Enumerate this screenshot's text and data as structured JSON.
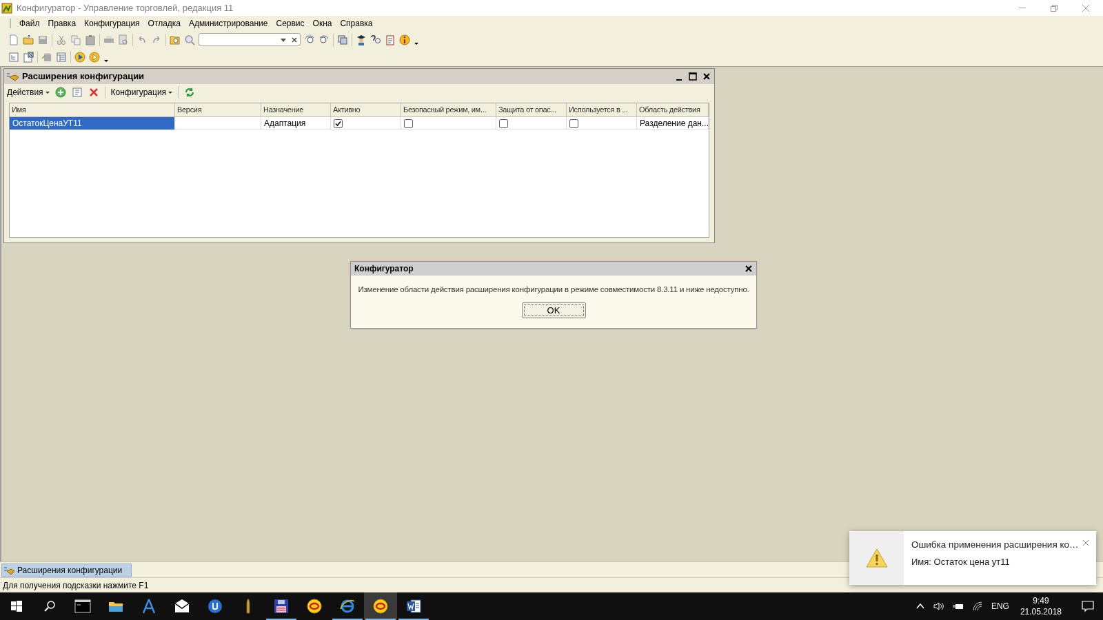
{
  "window": {
    "title": "Конфигуратор - Управление торговлей, редакция 11"
  },
  "menu": [
    {
      "label": "Файл"
    },
    {
      "label": "Правка"
    },
    {
      "label": "Конфигурация"
    },
    {
      "label": "Отладка"
    },
    {
      "label": "Администрирование"
    },
    {
      "label": "Сервис"
    },
    {
      "label": "Окна"
    },
    {
      "label": "Справка"
    }
  ],
  "child_window": {
    "title": "Расширения конфигурации",
    "toolbar": [
      {
        "kind": "menu",
        "label": "Действия"
      },
      {
        "kind": "add"
      },
      {
        "kind": "copy"
      },
      {
        "kind": "delete"
      },
      {
        "kind": "menu",
        "label": "Конфигурация"
      },
      {
        "kind": "refresh"
      }
    ],
    "table": {
      "columns": [
        "Имя",
        "Версия",
        "Назначение",
        "Активно",
        "Безопасный режим, им...",
        "Защита от опас...",
        "Используется в ...",
        "Область действия"
      ],
      "rows": [
        {
          "selected": true,
          "cells": [
            {
              "kind": "text",
              "text": "ОстатокЦенаУТ11"
            },
            {
              "kind": "empty"
            },
            {
              "kind": "text",
              "text": "Адаптация"
            },
            {
              "kind": "check",
              "checked": true
            },
            {
              "kind": "check",
              "checked": false
            },
            {
              "kind": "check",
              "checked": false
            },
            {
              "kind": "check",
              "checked": false
            },
            {
              "kind": "text",
              "text": "Разделение дан..."
            }
          ]
        }
      ]
    }
  },
  "dialog": {
    "title": "Конфигуратор",
    "message": "Изменение области действия расширения конфигурации в режиме совместимости 8.3.11 и ниже недоступно.",
    "button": "OK"
  },
  "window_tabs": [
    {
      "label": "Расширения конфигурации",
      "selected": true
    }
  ],
  "status_bar": {
    "hint": "Для получения подсказки нажмите F1"
  },
  "notification": {
    "title": "Ошибка применения расширения ко…",
    "body": "Имя: Остаток цена ут11"
  },
  "taskbar": {
    "apps": [
      {
        "kind": "terminal",
        "running": false,
        "selected": false
      },
      {
        "kind": "folder",
        "running": false,
        "selected": false
      },
      {
        "kind": "compass",
        "running": false,
        "selected": false
      },
      {
        "kind": "mail",
        "running": false,
        "selected": false
      },
      {
        "kind": "torrent",
        "running": false,
        "selected": false
      },
      {
        "kind": "bullet",
        "running": false,
        "selected": false
      },
      {
        "kind": "floppy",
        "running": true,
        "selected": false
      },
      {
        "kind": "onec",
        "running": false,
        "selected": false
      },
      {
        "kind": "browser",
        "running": true,
        "selected": false
      },
      {
        "kind": "onec",
        "running": true,
        "selected": true
      },
      {
        "kind": "word",
        "running": true,
        "selected": false
      }
    ]
  },
  "tray": {
    "language": "ENG",
    "time": "9:49",
    "date": "21.05.2018"
  }
}
